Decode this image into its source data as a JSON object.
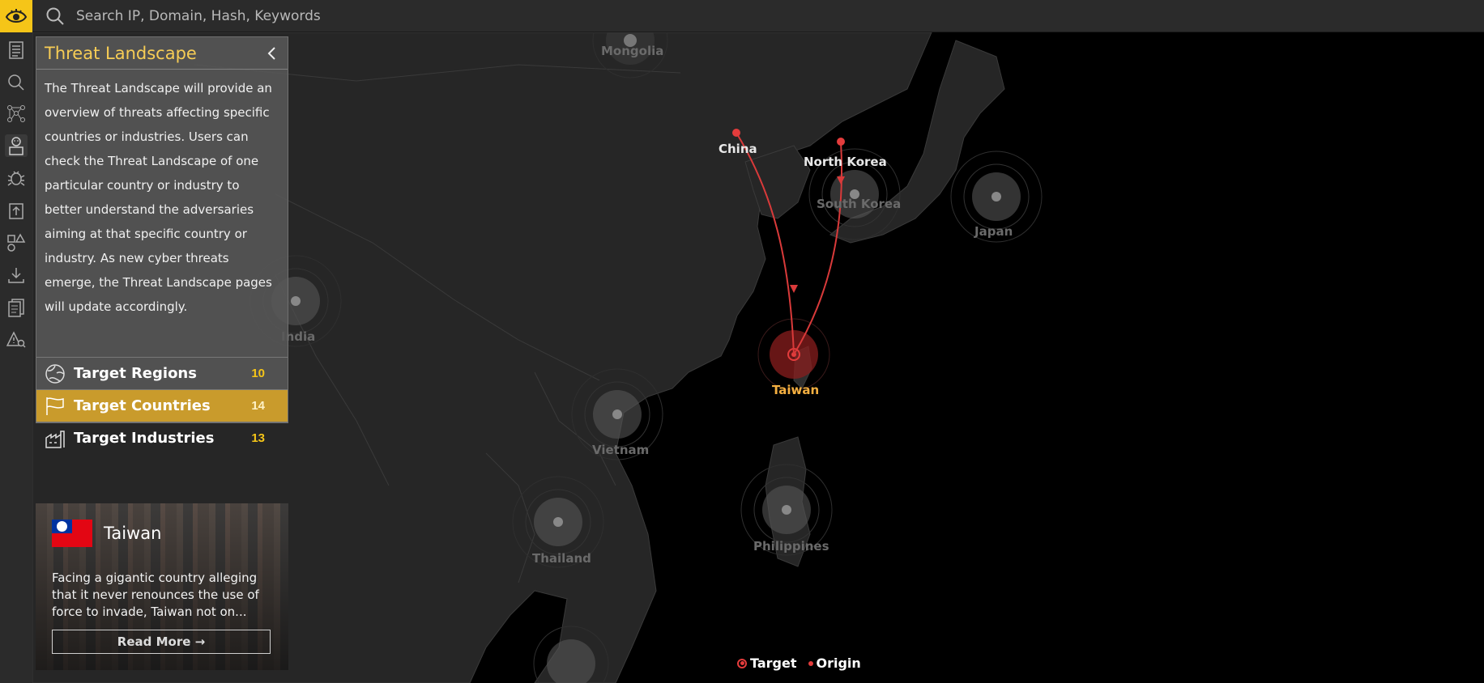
{
  "search": {
    "placeholder": "Search IP, Domain, Hash, Keywords"
  },
  "rail": {
    "items": [
      {
        "name": "reports-icon"
      },
      {
        "name": "search-icon"
      },
      {
        "name": "graph-icon"
      },
      {
        "name": "hacker-icon"
      },
      {
        "name": "malware-icon"
      },
      {
        "name": "upload-icon"
      },
      {
        "name": "shapes-icon"
      },
      {
        "name": "download-icon"
      },
      {
        "name": "documents-icon"
      },
      {
        "name": "alert-search-icon"
      }
    ]
  },
  "panel": {
    "title": "Threat Landscape",
    "description": "The Threat Landscape will provide an overview of threats affecting specific countries or industries. Users can check the Threat Landscape of one particular country or industry to better understand the adversaries aiming at that specific country or industry. As new cyber threats emerge, the Threat Landscape pages will update accordingly.",
    "rows": [
      {
        "label": "Target Regions",
        "count": "10"
      },
      {
        "label": "Target Countries",
        "count": "14"
      },
      {
        "label": "Target Industries",
        "count": "13"
      }
    ]
  },
  "map": {
    "labels": {
      "mongolia": "Mongolia",
      "china": "China",
      "north_korea": "North Korea",
      "south_korea": "South Korea",
      "japan": "Japan",
      "india": "India",
      "taiwan": "Taiwan",
      "vietnam": "Vietnam",
      "thailand": "Thailand",
      "philippines": "Philippines"
    },
    "target_color": "#e43c3c",
    "target_label_color": "#f5b041"
  },
  "card": {
    "title": "Taiwan",
    "text": "Facing a gigantic country alleging that it never renounces the use of force to invade, Taiwan not on...",
    "button": "Read More →"
  },
  "legend": {
    "target": "Target",
    "origin": "Origin"
  },
  "colors": {
    "accent": "#f5c518",
    "selected_row": "#c99b2c",
    "title": "#f7cd55"
  }
}
